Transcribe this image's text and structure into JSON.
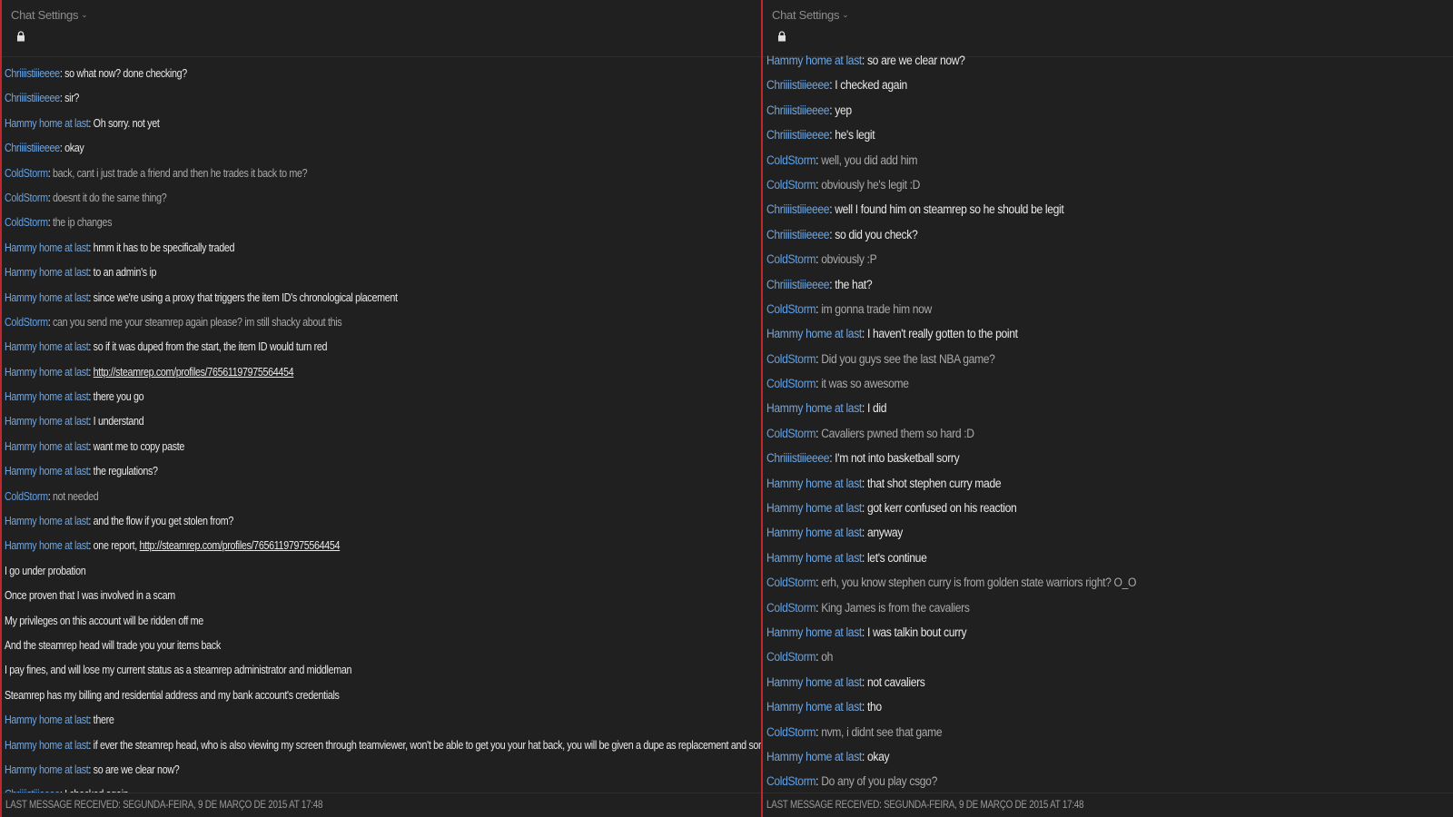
{
  "left": {
    "settings_label": "Chat Settings",
    "messages": [
      {
        "name": "Chriiiistiiieeee",
        "sep": ": ",
        "text": "so what now? done checking?",
        "kind": "user"
      },
      {
        "name": "Chriiiistiiieeee",
        "sep": ": ",
        "text": "sir?",
        "kind": "user"
      },
      {
        "name": "Hammy home at last",
        "sep": ": ",
        "text": "Oh sorry. not yet",
        "kind": "user"
      },
      {
        "name": "Chriiiistiiieeee",
        "sep": ": ",
        "text": "okay",
        "kind": "user"
      },
      {
        "name": "ColdStorm",
        "sep": ": ",
        "text": "back, cant i just trade a friend and then he trades it back to me?",
        "kind": "self"
      },
      {
        "name": "ColdStorm",
        "sep": ": ",
        "text": "doesnt it do the same thing?",
        "kind": "self"
      },
      {
        "name": "ColdStorm",
        "sep": ": ",
        "text": "the ip changes",
        "kind": "self"
      },
      {
        "name": "Hammy home at last",
        "sep": ": ",
        "text": "hmm it has to be specifically traded",
        "kind": "user"
      },
      {
        "name": "Hammy home at last",
        "sep": ": ",
        "text": "to an admin's ip",
        "kind": "user"
      },
      {
        "name": "Hammy home at last",
        "sep": ": ",
        "text": "since we're using a proxy that triggers the item ID's chronological placement",
        "kind": "user"
      },
      {
        "name": "ColdStorm",
        "sep": ": ",
        "text": "can you send me your steamrep again please? im still shacky about this",
        "kind": "self"
      },
      {
        "name": "Hammy home at last",
        "sep": ": ",
        "text": "so if it was duped from the start, the item ID would turn red",
        "kind": "user"
      },
      {
        "name": "Hammy home at last",
        "sep": ": ",
        "text": "",
        "link": "http://steamrep.com/profiles/76561197975564454",
        "kind": "user"
      },
      {
        "name": "Hammy home at last",
        "sep": ": ",
        "text": "there you go",
        "kind": "user"
      },
      {
        "name": "Hammy home at last",
        "sep": ": ",
        "text": "I understand",
        "kind": "user"
      },
      {
        "name": "Hammy home at last",
        "sep": ": ",
        "text": "want me to copy paste",
        "kind": "user"
      },
      {
        "name": "Hammy home at last",
        "sep": ": ",
        "text": "the regulations?",
        "kind": "user"
      },
      {
        "name": "ColdStorm",
        "sep": ": ",
        "text": "not needed",
        "kind": "self"
      },
      {
        "name": "Hammy home at last",
        "sep": ": ",
        "text": "and the flow if you get stolen from?",
        "kind": "user"
      },
      {
        "name": "Hammy home at last",
        "sep": ": ",
        "text": "one report, ",
        "link": "http://steamrep.com/profiles/76561197975564454",
        "kind": "user"
      },
      {
        "name": "",
        "sep": "",
        "text": "I go under probation",
        "kind": "plain"
      },
      {
        "name": "",
        "sep": "",
        "text": "Once proven that I was involved in a scam",
        "kind": "plain"
      },
      {
        "name": "",
        "sep": "",
        "text": "My privileges on this account will be ridden off me",
        "kind": "plain"
      },
      {
        "name": "",
        "sep": "",
        "text": "And the steamrep head will trade you your items back",
        "kind": "plain"
      },
      {
        "name": "",
        "sep": "",
        "text": "I pay fines, and will lose my current status as a steamrep administrator and middleman",
        "kind": "plain"
      },
      {
        "name": "",
        "sep": "",
        "text": "Steamrep has my billing and residential address and my bank account's credentials",
        "kind": "plain"
      },
      {
        "name": "Hammy home at last",
        "sep": ": ",
        "text": "there",
        "kind": "user"
      },
      {
        "name": "Hammy home at last",
        "sep": ": ",
        "text": "if ever the steamrep head, who is also viewing my screen through teamviewer, won't be able to get you your hat back, you will be given a dupe as replacement and some keys as compensation",
        "kind": "user"
      },
      {
        "name": "Hammy home at last",
        "sep": ": ",
        "text": "so are we clear now?",
        "kind": "user"
      },
      {
        "name": "Chriiiistiiieeee",
        "sep": ": ",
        "text": "I checked again",
        "kind": "user"
      }
    ],
    "footer": "LAST MESSAGE RECEIVED: SEGUNDA-FEIRA, 9 DE MARÇO DE 2015 AT 17:48"
  },
  "right": {
    "settings_label": "Chat Settings",
    "messages": [
      {
        "name": "Hammy home at last",
        "sep": ": ",
        "text": "so are we clear now?",
        "kind": "user"
      },
      {
        "name": "Chriiiistiiieeee",
        "sep": ": ",
        "text": "I checked again",
        "kind": "user"
      },
      {
        "name": "Chriiiistiiieeee",
        "sep": ": ",
        "text": "yep",
        "kind": "user"
      },
      {
        "name": "Chriiiistiiieeee",
        "sep": ": ",
        "text": "he's legit",
        "kind": "user"
      },
      {
        "name": "ColdStorm",
        "sep": ": ",
        "text": "well, you did add him",
        "kind": "self"
      },
      {
        "name": "ColdStorm",
        "sep": ": ",
        "text": "obviously he's legit :D",
        "kind": "self"
      },
      {
        "name": "Chriiiistiiieeee",
        "sep": ": ",
        "text": "well I found him on steamrep so he should be legit",
        "kind": "user"
      },
      {
        "name": "Chriiiistiiieeee",
        "sep": ": ",
        "text": "so did you check?",
        "kind": "user"
      },
      {
        "name": "ColdStorm",
        "sep": ": ",
        "text": "obviously :P",
        "kind": "self"
      },
      {
        "name": "Chriiiistiiieeee",
        "sep": ": ",
        "text": "the hat?",
        "kind": "user"
      },
      {
        "name": "ColdStorm",
        "sep": ": ",
        "text": "im gonna trade him now",
        "kind": "self"
      },
      {
        "name": "Hammy home at last",
        "sep": ": ",
        "text": "I haven't really gotten to the point",
        "kind": "user"
      },
      {
        "name": "ColdStorm",
        "sep": ": ",
        "text": "Did you guys see the last NBA game?",
        "kind": "self"
      },
      {
        "name": "ColdStorm",
        "sep": ": ",
        "text": "it was so awesome",
        "kind": "self"
      },
      {
        "name": "Hammy home at last",
        "sep": ": ",
        "text": "I did",
        "kind": "user"
      },
      {
        "name": "ColdStorm",
        "sep": ": ",
        "text": "Cavaliers pwned them so hard :D",
        "kind": "self"
      },
      {
        "name": "Chriiiistiiieeee",
        "sep": ": ",
        "text": "I'm not into basketball sorry",
        "kind": "user"
      },
      {
        "name": "Hammy home at last",
        "sep": ": ",
        "text": "that shot stephen curry made",
        "kind": "user"
      },
      {
        "name": "Hammy home at last",
        "sep": ": ",
        "text": "got kerr confused on his reaction",
        "kind": "user"
      },
      {
        "name": "Hammy home at last",
        "sep": ": ",
        "text": "anyway",
        "kind": "user"
      },
      {
        "name": "Hammy home at last",
        "sep": ": ",
        "text": "let's continue",
        "kind": "user"
      },
      {
        "name": "ColdStorm",
        "sep": ": ",
        "text": "erh, you know stephen curry is from golden state warriors right? O_O",
        "kind": "self"
      },
      {
        "name": "ColdStorm",
        "sep": ": ",
        "text": "King James is from the cavaliers",
        "kind": "self"
      },
      {
        "name": "Hammy home at last",
        "sep": ": ",
        "text": "I was talkin bout curry",
        "kind": "user"
      },
      {
        "name": "ColdStorm",
        "sep": ": ",
        "text": "oh",
        "kind": "self"
      },
      {
        "name": "Hammy home at last",
        "sep": ": ",
        "text": "not cavaliers",
        "kind": "user"
      },
      {
        "name": "Hammy home at last",
        "sep": ": ",
        "text": "tho",
        "kind": "user"
      },
      {
        "name": "ColdStorm",
        "sep": ": ",
        "text": "nvm, i didnt see that game",
        "kind": "self"
      },
      {
        "name": "Hammy home at last",
        "sep": ": ",
        "text": "okay",
        "kind": "user"
      },
      {
        "name": "ColdStorm",
        "sep": ": ",
        "text": "Do any of you play csgo?",
        "kind": "self"
      }
    ],
    "footer": "LAST MESSAGE RECEIVED: SEGUNDA-FEIRA, 9 DE MARÇO DE 2015 AT 17:48"
  },
  "colors": {
    "name_blue": "#6ea5e0",
    "divider_red": "#c0282e",
    "background": "#202020"
  }
}
